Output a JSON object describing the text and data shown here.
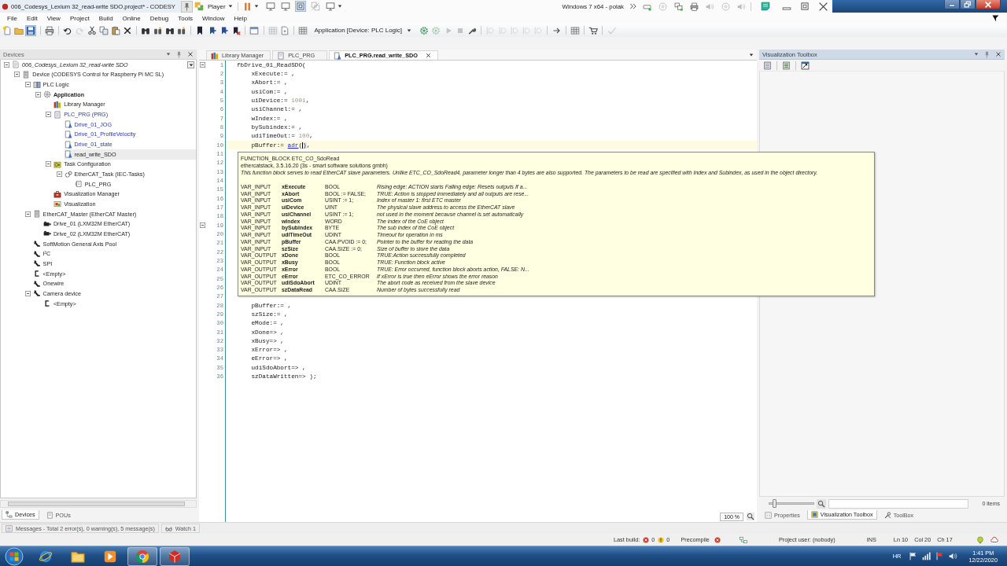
{
  "window": {
    "title": "006_Codesys_Lexium 32_read-write SDO.project* - CODESY"
  },
  "vm_toolbar": {
    "menu": "Player",
    "machine": "Windows 7 x64 - polak"
  },
  "menu": [
    "File",
    "Edit",
    "View",
    "Project",
    "Build",
    "Online",
    "Debug",
    "Tools",
    "Window",
    "Help"
  ],
  "toolbar": {
    "active_application": "Application [Device: PLC Logic]"
  },
  "devices": {
    "title": "Devices",
    "tree": [
      {
        "label": "006_Codesys_Lexium 32_read-write SDO",
        "kind": "project",
        "selected": false,
        "expanded": true,
        "children": [
          {
            "label": "Device (CODESYS Control for Raspberry Pi MC SL)",
            "kind": "device",
            "selected": false,
            "expanded": true,
            "children": [
              {
                "label": "PLC Logic",
                "kind": "plc-logic",
                "selected": false,
                "expanded": true,
                "children": [
                  {
                    "label": "Application",
                    "kind": "application",
                    "selected": false,
                    "expanded": true,
                    "children": [
                      {
                        "label": "Library Manager",
                        "kind": "library",
                        "selected": false
                      },
                      {
                        "label": "PLC_PRG (PRG)",
                        "kind": "pou",
                        "selected": false,
                        "expanded": true,
                        "children": [
                          {
                            "label": "Drive_01_JOG",
                            "kind": "action",
                            "selected": false
                          },
                          {
                            "label": "Drive_01_ProfileVelocity",
                            "kind": "action",
                            "selected": false
                          },
                          {
                            "label": "Drive_01_state",
                            "kind": "action",
                            "selected": false
                          },
                          {
                            "label": "read_write_SDO",
                            "kind": "action",
                            "selected": true
                          }
                        ]
                      },
                      {
                        "label": "Task Configuration",
                        "kind": "task-config",
                        "selected": false,
                        "expanded": true,
                        "children": [
                          {
                            "label": "EtherCAT_Task (IEC-Tasks)",
                            "kind": "task",
                            "selected": false,
                            "expanded": true,
                            "children": [
                              {
                                "label": "PLC_PRG",
                                "kind": "task-call",
                                "selected": false
                              }
                            ]
                          }
                        ]
                      },
                      {
                        "label": "Visualization Manager",
                        "kind": "vis-manager",
                        "selected": false
                      },
                      {
                        "label": "Visualization",
                        "kind": "visualization",
                        "selected": false
                      }
                    ]
                  }
                ]
              },
              {
                "label": "EtherCAT_Master (EtherCAT Master)",
                "kind": "ethercat-master",
                "selected": false,
                "expanded": true,
                "children": [
                  {
                    "label": "Drive_01 (LXM32M EtherCAT)",
                    "kind": "drive",
                    "selected": false
                  },
                  {
                    "label": "Drive_02 (LXM32M EtherCAT)",
                    "kind": "drive",
                    "selected": false
                  }
                ]
              },
              {
                "label": "SoftMotion General Axis Pool",
                "kind": "bus",
                "selected": false
              },
              {
                "label": "I²C",
                "kind": "bus",
                "selected": false
              },
              {
                "label": "SPI",
                "kind": "bus",
                "selected": false
              },
              {
                "label": "<Empty>",
                "kind": "empty",
                "selected": false
              },
              {
                "label": "Onewire",
                "kind": "bus",
                "selected": false
              },
              {
                "label": "Camera device",
                "kind": "bus",
                "selected": false,
                "expanded": true,
                "children": [
                  {
                    "label": "<Empty>",
                    "kind": "empty",
                    "selected": false
                  }
                ]
              }
            ]
          }
        ]
      }
    ],
    "tabs": [
      {
        "label": "Devices",
        "selected": true
      },
      {
        "label": "POUs",
        "selected": false
      }
    ]
  },
  "editor": {
    "tabs": [
      {
        "label": "Library Manager",
        "kind": "library",
        "selected": false
      },
      {
        "label": "PLC_PRG",
        "kind": "pou",
        "selected": false
      },
      {
        "label": "PLC_PRG.read_write_SDO",
        "kind": "action",
        "selected": true
      }
    ],
    "lines": [
      {
        "number": "1",
        "current": false,
        "fold_marker": true,
        "code": "fbDrive_01_ReadSDO("
      },
      {
        "number": "2",
        "current": false,
        "fold_marker": false,
        "code": "    xExecute:= ,"
      },
      {
        "number": "3",
        "current": false,
        "fold_marker": false,
        "code": "    xAbort:= ,"
      },
      {
        "number": "4",
        "current": false,
        "fold_marker": false,
        "code": "    usiCom:= ,"
      },
      {
        "number": "5",
        "current": false,
        "fold_marker": false,
        "tokens": [
          {
            "kind": "text",
            "text": "    uiDevice:= "
          },
          {
            "kind": "number",
            "text": "1001"
          },
          {
            "kind": "text",
            "text": ","
          }
        ]
      },
      {
        "number": "6",
        "current": false,
        "fold_marker": false,
        "code": "    usiChannel:= ,"
      },
      {
        "number": "7",
        "current": false,
        "fold_marker": false,
        "code": "    wIndex:= ,"
      },
      {
        "number": "8",
        "current": false,
        "fold_marker": false,
        "code": "    bySubindex:= ,"
      },
      {
        "number": "9",
        "current": false,
        "fold_marker": false,
        "tokens": [
          {
            "kind": "text",
            "text": "    udiTimeOut:= "
          },
          {
            "kind": "number",
            "text": "100"
          },
          {
            "kind": "text",
            "text": ","
          }
        ]
      },
      {
        "number": "10",
        "current": true,
        "fold_marker": false,
        "tokens": [
          {
            "kind": "text",
            "text": "    pBuffer:= "
          },
          {
            "kind": "function",
            "text": "adr"
          },
          {
            "kind": "text",
            "text": "("
          },
          {
            "kind": "caret",
            "text": ")"
          },
          {
            "kind": "text",
            "text": ","
          }
        ]
      },
      {
        "number": "11",
        "current": false,
        "fold_marker": false
      },
      {
        "number": "12",
        "current": false,
        "fold_marker": false
      },
      {
        "number": "13",
        "current": false,
        "fold_marker": false
      },
      {
        "number": "14",
        "current": false,
        "fold_marker": false
      },
      {
        "number": "15",
        "current": false,
        "fold_marker": false
      },
      {
        "number": "16",
        "current": false,
        "fold_marker": false
      },
      {
        "number": "17",
        "current": false,
        "fold_marker": false
      },
      {
        "number": "18",
        "current": false,
        "fold_marker": false
      },
      {
        "number": "19",
        "current": false,
        "fold_marker": true
      },
      {
        "number": "20",
        "current": false,
        "fold_marker": false
      },
      {
        "number": "21",
        "current": false,
        "fold_marker": false
      },
      {
        "number": "22",
        "current": false,
        "fold_marker": false
      },
      {
        "number": "23",
        "current": false,
        "fold_marker": false
      },
      {
        "number": "24",
        "current": false,
        "fold_marker": false
      },
      {
        "number": "25",
        "current": false,
        "fold_marker": false
      },
      {
        "number": "26",
        "current": false,
        "fold_marker": false
      },
      {
        "number": "27",
        "current": false,
        "fold_marker": false
      },
      {
        "number": "28",
        "current": false,
        "fold_marker": false,
        "code": "    pBuffer:= ,"
      },
      {
        "number": "29",
        "current": false,
        "fold_marker": false,
        "code": "    szSize:= ,"
      },
      {
        "number": "30",
        "current": false,
        "fold_marker": false,
        "code": "    eMode:= ,"
      },
      {
        "number": "31",
        "current": false,
        "fold_marker": false,
        "code": "    xDone=> ,"
      },
      {
        "number": "32",
        "current": false,
        "fold_marker": false,
        "code": "    xBusy=> ,"
      },
      {
        "number": "33",
        "current": false,
        "fold_marker": false,
        "code": "    xError=> ,"
      },
      {
        "number": "34",
        "current": false,
        "fold_marker": false,
        "code": "    eError=> ,"
      },
      {
        "number": "35",
        "current": false,
        "fold_marker": false,
        "code": "    udiSdoAbort=> ,"
      },
      {
        "number": "36",
        "current": false,
        "fold_marker": false,
        "code": "    szDataWritten=> );"
      }
    ],
    "zoom": "100 %",
    "tooltip": {
      "declaration": "FUNCTION_BLOCK ETC_CO_SdoRead",
      "library": "ethercatstack, 3.5.16.20 (3s - smart software solutions gmbh)",
      "description": "This function block serves to read EtherCAT slave parameters. Unlike ETC_CO_SdoRead4, parameter longer than 4 bytes are also supported. The parameters to be read are specified with Index and Subindex, as used in the object directory.",
      "params": [
        {
          "class": "VAR_INPUT",
          "name": "xExecute",
          "type": "BOOL",
          "comment": "Rising edge: ACTION starts Falling edge: Resets outputs If a..."
        },
        {
          "class": "VAR_INPUT",
          "name": "xAbort",
          "type": "BOOL := FALSE;",
          "comment": "TRUE: Action is stopped immediately and all outputs are rese..."
        },
        {
          "class": "VAR_INPUT",
          "name": "usiCom",
          "type": "USINT := 1;",
          "comment": "Index of master 1: first ETC master"
        },
        {
          "class": "VAR_INPUT",
          "name": "uiDevice",
          "type": "UINT",
          "comment": "The physical slave address to access the EtherCAT slave"
        },
        {
          "class": "VAR_INPUT",
          "name": "usiChannel",
          "type": "USINT := 1;",
          "comment": "not used in the moment because channel is set automatically"
        },
        {
          "class": "VAR_INPUT",
          "name": "wIndex",
          "type": "WORD",
          "comment": "The index of the CoE object"
        },
        {
          "class": "VAR_INPUT",
          "name": "bySubindex",
          "type": "BYTE",
          "comment": "The sub index of the CoE object"
        },
        {
          "class": "VAR_INPUT",
          "name": "udiTimeOut",
          "type": "UDINT",
          "comment": "Timeout for operation in ms"
        },
        {
          "class": "VAR_INPUT",
          "name": "pBuffer",
          "type": "CAA.PVOID := 0;",
          "comment": "Pointer to the buffer for reading the data"
        },
        {
          "class": "VAR_INPUT",
          "name": "szSize",
          "type": "CAA.SIZE := 0;",
          "comment": "Size of buffer to store the data"
        },
        {
          "class": "VAR_OUTPUT",
          "name": "xDone",
          "type": "BOOL",
          "comment": "TRUE:Action successfully completed"
        },
        {
          "class": "VAR_OUTPUT",
          "name": "xBusy",
          "type": "BOOL",
          "comment": "TRUE: Function block active"
        },
        {
          "class": "VAR_OUTPUT",
          "name": "xError",
          "type": "BOOL",
          "comment": "TRUE: Error occurred, function block aborts action, FALSE: N..."
        },
        {
          "class": "VAR_OUTPUT",
          "name": "eError",
          "type": "ETC_CO_ERROR",
          "comment": "If xError is true then eError shows the error reason"
        },
        {
          "class": "VAR_OUTPUT",
          "name": "udiSdoAbort",
          "type": "UDINT",
          "comment": "The abort code as received from the slave device"
        },
        {
          "class": "VAR_OUTPUT",
          "name": "szDataRead",
          "type": "CAA.SIZE",
          "comment": "Number of bytes successfully read"
        }
      ]
    }
  },
  "toolbox": {
    "title": "Visualization Toolbox",
    "size_slider": {
      "level": 0.1
    },
    "count": "0 items",
    "tabs": [
      {
        "label": "Properties",
        "kind": "properties",
        "selected": false
      },
      {
        "label": "Visualization Toolbox",
        "kind": "visual",
        "selected": true
      },
      {
        "label": "ToolBox",
        "kind": "tools",
        "selected": false
      }
    ]
  },
  "messages": {
    "tabs": [
      {
        "label": "Messages - Total 2 error(s), 0 warning(s), 5 message(s)",
        "kind": "messages",
        "selected": false
      },
      {
        "label": "Watch 1",
        "kind": "watch",
        "selected": false
      }
    ]
  },
  "status_bar": {
    "last_build": "Last build:",
    "errors": "0",
    "warnings": "0",
    "precompile": "Precompile",
    "project_user": "Project user: (nobody)",
    "mode": "INS",
    "line": "Ln 10",
    "column": "Col 20",
    "char": "Ch 17"
  },
  "taskbar": {
    "apps": [
      {
        "kind": "globe",
        "active": false
      },
      {
        "kind": "folder",
        "active": false
      },
      {
        "kind": "player",
        "active": false
      },
      {
        "kind": "browser",
        "active": true
      },
      {
        "kind": "cube",
        "active": true
      }
    ],
    "language": "HR",
    "time": "1:41 PM",
    "date": "12/22/2020"
  }
}
